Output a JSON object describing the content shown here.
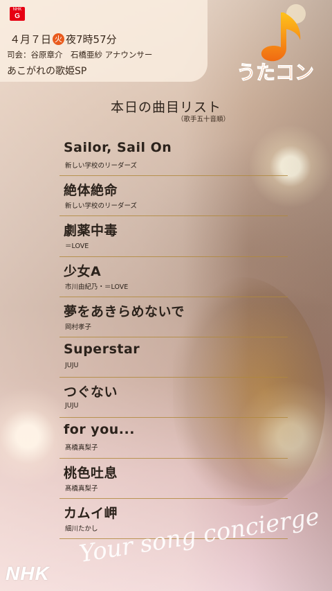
{
  "header": {
    "channel": {
      "network": "NHK",
      "code": "G"
    },
    "air": {
      "date": "４月７日",
      "weekday": "火",
      "time": "夜7時57分"
    },
    "hosts": "司会：谷原章介　石橋亜紗 アナウンサー",
    "program": "あこがれの歌姫SP"
  },
  "logo": {
    "text": "うたコン",
    "icon": "music-note-icon"
  },
  "setlist": {
    "title": "本日の曲目リスト",
    "note": "（歌手五十音順）",
    "songs": [
      {
        "title": "Sailor, Sail On",
        "artist": "新しい学校のリーダーズ"
      },
      {
        "title": "絶体絶命",
        "artist": "新しい学校のリーダーズ"
      },
      {
        "title": "劇薬中毒",
        "artist": "＝LOVE"
      },
      {
        "title": "少女A",
        "artist": "市川由紀乃・＝LOVE"
      },
      {
        "title": "夢をあきらめないで",
        "artist": "岡村孝子"
      },
      {
        "title": "Superstar",
        "artist": "JUJU"
      },
      {
        "title": "つぐない",
        "artist": "JUJU"
      },
      {
        "title": "for you...",
        "artist": "髙橋真梨子"
      },
      {
        "title": "桃色吐息",
        "artist": "髙橋真梨子"
      },
      {
        "title": "カムイ岬",
        "artist": "細川たかし"
      }
    ]
  },
  "footer": {
    "broadcaster": "NHK",
    "tagline": "Your song concierge"
  },
  "colors": {
    "accent": "#e95a1c",
    "badge": "#e60012",
    "rule": "#b0883c"
  }
}
